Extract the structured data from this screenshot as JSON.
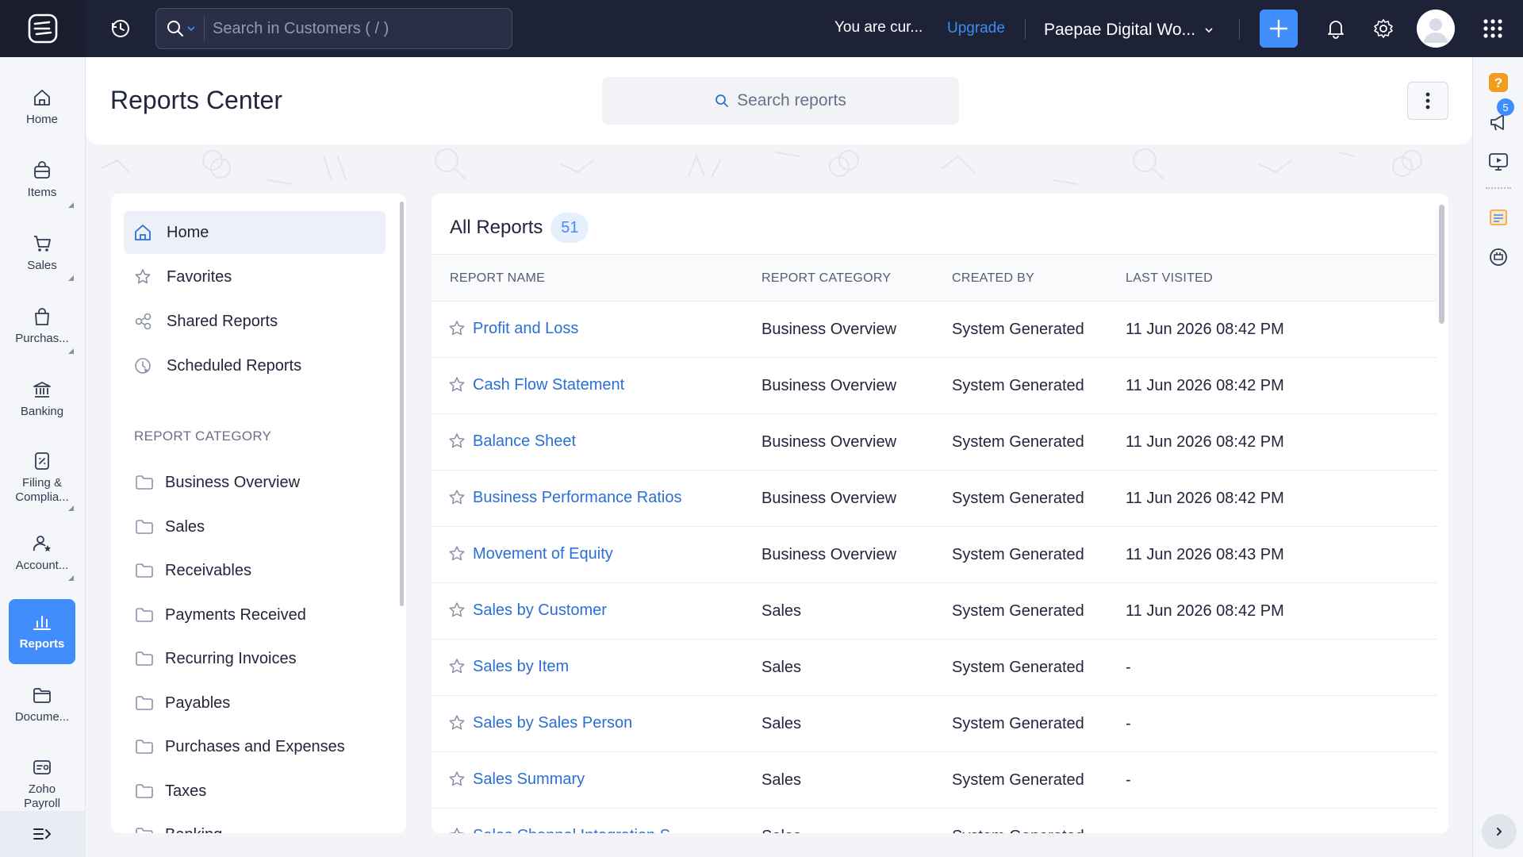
{
  "topbar": {
    "search_placeholder": "Search in Customers ( / )",
    "trial_text": "You are cur...",
    "upgrade_label": "Upgrade",
    "org_name": "Paepae Digital Wo..."
  },
  "leftnav": {
    "items": [
      {
        "label": "Home",
        "icon": "home-icon"
      },
      {
        "label": "Items",
        "icon": "items-icon"
      },
      {
        "label": "Sales",
        "icon": "cart-icon"
      },
      {
        "label": "Purchas...",
        "icon": "bag-icon"
      },
      {
        "label": "Banking",
        "icon": "bank-icon"
      },
      {
        "label": "Filing & Complia...",
        "icon": "filing-icon"
      },
      {
        "label": "Account...",
        "icon": "accountant-icon"
      },
      {
        "label": "Reports",
        "icon": "bar-chart-icon"
      },
      {
        "label": "Docume...",
        "icon": "folder-icon"
      },
      {
        "label": "Zoho Payroll",
        "icon": "payroll-icon"
      }
    ]
  },
  "header": {
    "title": "Reports Center",
    "search_placeholder": "Search reports"
  },
  "left_panel": {
    "items": [
      {
        "label": "Home",
        "icon": "home-icon"
      },
      {
        "label": "Favorites",
        "icon": "star-icon"
      },
      {
        "label": "Shared Reports",
        "icon": "share-icon"
      },
      {
        "label": "Scheduled Reports",
        "icon": "clock-icon"
      }
    ],
    "section_label": "REPORT CATEGORY",
    "categories": [
      "Business Overview",
      "Sales",
      "Receivables",
      "Payments Received",
      "Recurring Invoices",
      "Payables",
      "Purchases and Expenses",
      "Taxes",
      "Banking"
    ]
  },
  "table": {
    "title": "All Reports",
    "count": "51",
    "columns": [
      "REPORT NAME",
      "REPORT CATEGORY",
      "CREATED BY",
      "LAST VISITED"
    ],
    "rows": [
      {
        "name": "Profit and Loss",
        "category": "Business Overview",
        "created_by": "System Generated",
        "last_visited": "11 Jun 2026 08:42 PM"
      },
      {
        "name": "Cash Flow Statement",
        "category": "Business Overview",
        "created_by": "System Generated",
        "last_visited": "11 Jun 2026 08:42 PM"
      },
      {
        "name": "Balance Sheet",
        "category": "Business Overview",
        "created_by": "System Generated",
        "last_visited": "11 Jun 2026 08:42 PM"
      },
      {
        "name": "Business Performance Ratios",
        "category": "Business Overview",
        "created_by": "System Generated",
        "last_visited": "11 Jun 2026 08:42 PM"
      },
      {
        "name": "Movement of Equity",
        "category": "Business Overview",
        "created_by": "System Generated",
        "last_visited": "11 Jun 2026 08:43 PM"
      },
      {
        "name": "Sales by Customer",
        "category": "Sales",
        "created_by": "System Generated",
        "last_visited": "11 Jun 2026 08:42 PM"
      },
      {
        "name": "Sales by Item",
        "category": "Sales",
        "created_by": "System Generated",
        "last_visited": "-"
      },
      {
        "name": "Sales by Sales Person",
        "category": "Sales",
        "created_by": "System Generated",
        "last_visited": "-"
      },
      {
        "name": "Sales Summary",
        "category": "Sales",
        "created_by": "System Generated",
        "last_visited": "-"
      },
      {
        "name": "Sales Channel Integration S...",
        "category": "Sales",
        "created_by": "System Generated",
        "last_visited": "-"
      }
    ]
  },
  "rightrail": {
    "notification_count": "5"
  },
  "colors": {
    "accent": "#408dfb",
    "topbar": "#1e2237",
    "link": "#2a6fd6"
  }
}
